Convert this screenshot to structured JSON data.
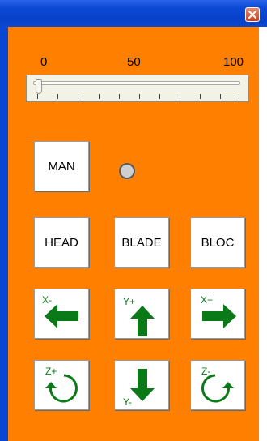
{
  "window": {
    "close_icon": "close-icon"
  },
  "slider": {
    "min_label": "0",
    "mid_label": "50",
    "max_label": "100",
    "value": 0
  },
  "buttons": {
    "man": "MAN",
    "head": "HEAD",
    "blade": "BLADE",
    "bloc": "BLOC"
  },
  "jog": {
    "x_minus": "X-",
    "y_plus": "Y+",
    "x_plus": "X+",
    "z_plus": "Z+",
    "y_minus": "Y-",
    "z_minus": "Z-"
  },
  "colors": {
    "panel": "#ff7f00",
    "titlebar": "#0b49d6",
    "arrow": "#0a7a18"
  }
}
